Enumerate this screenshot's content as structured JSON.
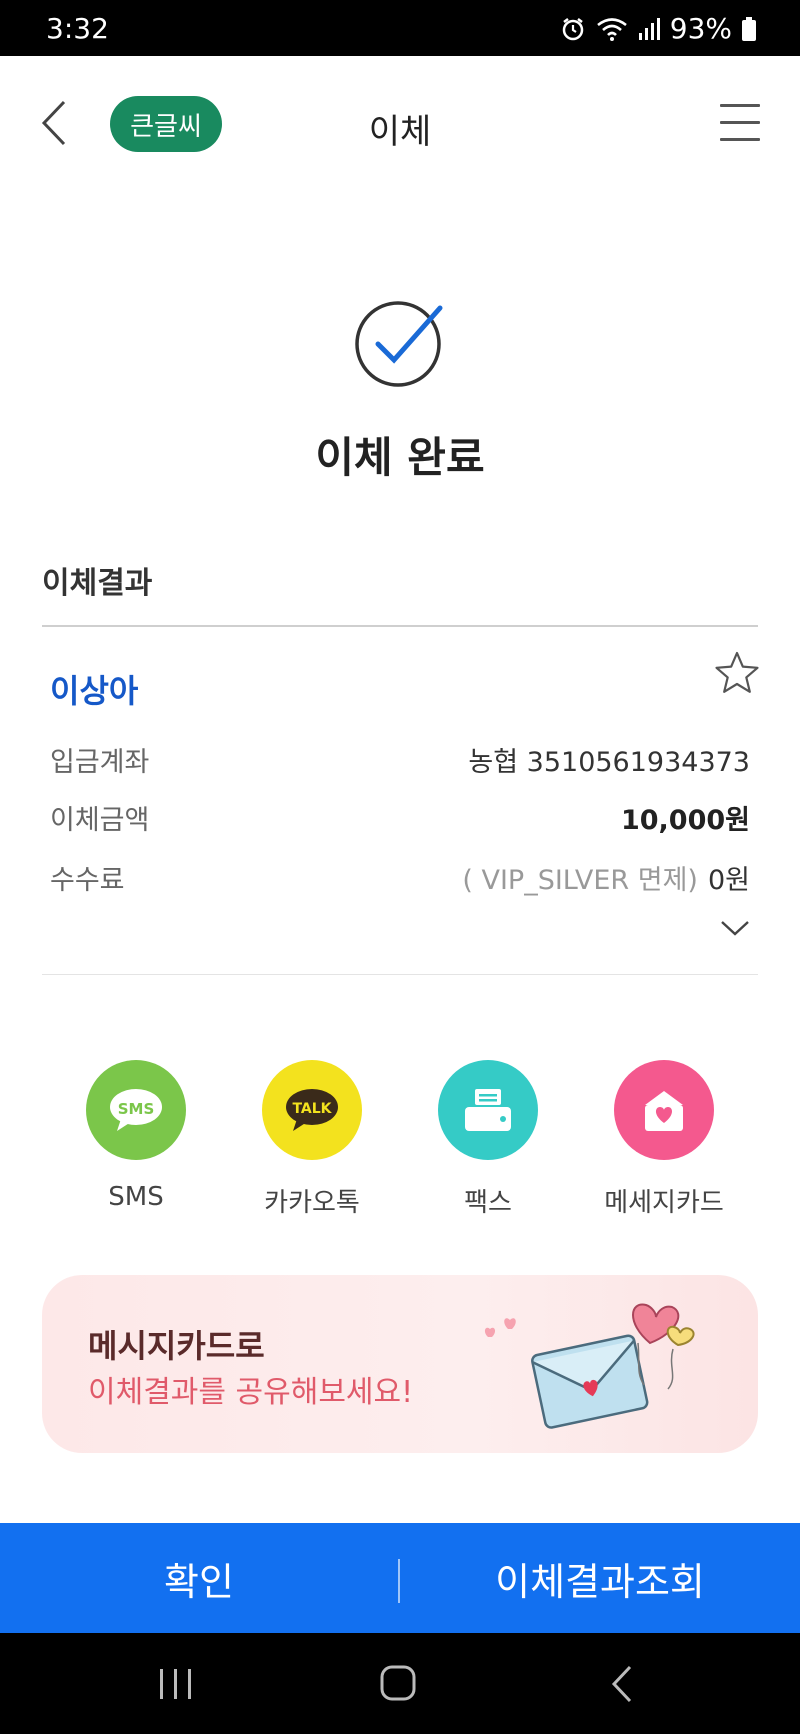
{
  "status_bar": {
    "time": "3:32",
    "battery": "93%"
  },
  "header": {
    "big_text_label": "큰글씨",
    "title": "이체"
  },
  "result": {
    "done_title": "이체 완료",
    "section_title": "이체결과",
    "recipient_name": "이상아",
    "rows": [
      {
        "label": "입금계좌",
        "value": "농협 3510561934373"
      },
      {
        "label": "이체금액",
        "value": "10,000원"
      },
      {
        "label": "수수료",
        "note": "( VIP_SILVER 면제)",
        "value": "0원"
      }
    ]
  },
  "share": {
    "items": [
      {
        "label": "SMS",
        "icon": "sms-icon",
        "color": "#7bc64a"
      },
      {
        "label": "카카오톡",
        "icon": "kakaotalk-icon",
        "color": "#f3e21e"
      },
      {
        "label": "팩스",
        "icon": "fax-icon",
        "color": "#35cbc6"
      },
      {
        "label": "메세지카드",
        "icon": "message-card-icon",
        "color": "#f4598e"
      }
    ],
    "sms_badge": "SMS",
    "talk_badge": "TALK"
  },
  "promo": {
    "line1": "메시지카드로",
    "line2": "이체결과를 공유해보세요!"
  },
  "actions": {
    "confirm_label": "확인",
    "view_result_label": "이체결과조회"
  },
  "colors": {
    "accent_blue": "#1270f0",
    "badge_green": "#198a5f",
    "name_blue": "#1558c8"
  }
}
